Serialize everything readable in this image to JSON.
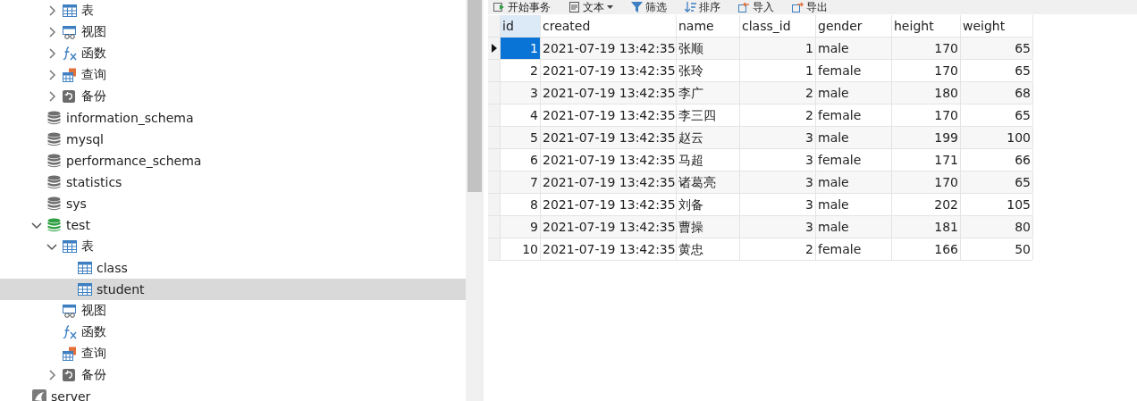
{
  "sidebar": {
    "tree": [
      {
        "children": [
          {
            "children": [
              {
                "label": "表",
                "kind": "table",
                "expanded": false,
                "selected": false
              },
              {
                "label": "视图",
                "kind": "view",
                "expanded": false,
                "selected": false
              },
              {
                "label": "函数",
                "kind": "function",
                "expanded": false,
                "selected": false
              },
              {
                "label": "查询",
                "kind": "query",
                "expanded": false,
                "selected": false
              },
              {
                "label": "备份",
                "kind": "backup",
                "expanded": false,
                "selected": false
              }
            ]
          },
          {
            "label": "information_schema",
            "kind": "database",
            "open": false,
            "selected": false
          },
          {
            "label": "mysql",
            "kind": "database",
            "open": false,
            "selected": false
          },
          {
            "label": "performance_schema",
            "kind": "database",
            "open": false,
            "selected": false
          },
          {
            "label": "statistics",
            "kind": "database",
            "open": false,
            "selected": false
          },
          {
            "label": "sys",
            "kind": "database",
            "open": false,
            "selected": false
          },
          {
            "label": "test",
            "kind": "database",
            "open": true,
            "expanded": true,
            "selected": false,
            "children": [
              {
                "label": "表",
                "kind": "table",
                "expanded": true,
                "selected": false,
                "children": [
                  {
                    "label": "class",
                    "kind": "table",
                    "selected": false
                  },
                  {
                    "label": "student",
                    "kind": "table",
                    "selected": true
                  }
                ]
              },
              {
                "label": "视图",
                "kind": "view",
                "selected": false
              },
              {
                "label": "函数",
                "kind": "function",
                "selected": false
              },
              {
                "label": "查询",
                "kind": "query",
                "selected": false
              },
              {
                "label": "备份",
                "kind": "backup",
                "expanded": false,
                "selected": false
              }
            ]
          }
        ]
      },
      {
        "label": "server",
        "kind": "server",
        "selected": false
      }
    ]
  },
  "toolbar": [
    {
      "label": "开始事务",
      "kind": "transaction"
    },
    {
      "label": "文本",
      "kind": "text",
      "dropdown": true
    },
    {
      "label": "筛选",
      "kind": "filter"
    },
    {
      "label": "排序",
      "kind": "sort"
    },
    {
      "label": "导入",
      "kind": "import"
    },
    {
      "label": "导出",
      "kind": "export"
    }
  ],
  "table": {
    "columns": [
      "id",
      "created",
      "name",
      "class_id",
      "gender",
      "height",
      "weight"
    ],
    "rows": [
      {
        "selected": true,
        "cells": [
          "1",
          "2021-07-19 13:42:35",
          "张顺",
          "1",
          "male",
          "170",
          "65"
        ]
      },
      {
        "selected": false,
        "cells": [
          "2",
          "2021-07-19 13:42:35",
          "张玲",
          "1",
          "female",
          "170",
          "65"
        ]
      },
      {
        "selected": false,
        "cells": [
          "3",
          "2021-07-19 13:42:35",
          "李广",
          "2",
          "male",
          "180",
          "68"
        ]
      },
      {
        "selected": false,
        "cells": [
          "4",
          "2021-07-19 13:42:35",
          "李三四",
          "2",
          "female",
          "170",
          "65"
        ]
      },
      {
        "selected": false,
        "cells": [
          "5",
          "2021-07-19 13:42:35",
          "赵云",
          "3",
          "male",
          "199",
          "100"
        ]
      },
      {
        "selected": false,
        "cells": [
          "6",
          "2021-07-19 13:42:35",
          "马超",
          "3",
          "female",
          "171",
          "66"
        ]
      },
      {
        "selected": false,
        "cells": [
          "7",
          "2021-07-19 13:42:35",
          "诸葛亮",
          "3",
          "male",
          "170",
          "65"
        ]
      },
      {
        "selected": false,
        "cells": [
          "8",
          "2021-07-19 13:42:35",
          "刘备",
          "3",
          "male",
          "202",
          "105"
        ]
      },
      {
        "selected": false,
        "cells": [
          "9",
          "2021-07-19 13:42:35",
          "曹操",
          "3",
          "male",
          "181",
          "80"
        ]
      },
      {
        "selected": false,
        "cells": [
          "10",
          "2021-07-19 13:42:35",
          "黄忠",
          "2",
          "female",
          "166",
          "50"
        ]
      }
    ]
  }
}
